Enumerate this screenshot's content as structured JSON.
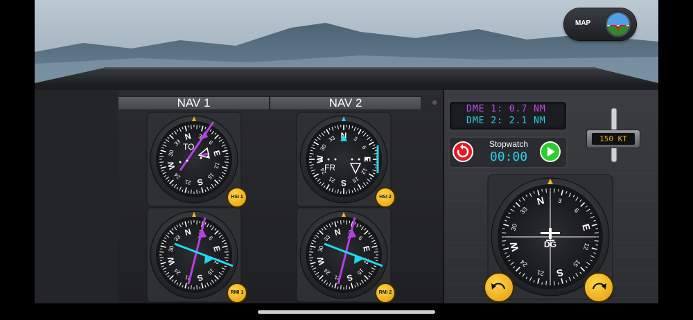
{
  "map_button": {
    "label": "MAP"
  },
  "nav_headers": {
    "nav1": "NAV 1",
    "nav2": "NAV 2"
  },
  "instruments": {
    "hsi1": {
      "label": "HSI 1",
      "flag": "TO"
    },
    "hsi2": {
      "label": "HSI 2",
      "flag": "FR"
    },
    "rmi1": {
      "label": "RMI 1"
    },
    "rmi2": {
      "label": "RMI 2"
    },
    "dg": {
      "label": "DG"
    }
  },
  "compass_labels": [
    "N",
    "3",
    "6",
    "E",
    "12",
    "15",
    "S",
    "21",
    "24",
    "W",
    "30",
    "33"
  ],
  "dme": {
    "line1": "DME 1: 0.7 NM",
    "line2": "DME 2: 2.1 NM"
  },
  "stopwatch": {
    "title": "Stopwatch",
    "time": "00:00"
  },
  "speed": {
    "value": "150 KT"
  },
  "colors": {
    "purple": "#b73fe6",
    "cyan": "#23d6f0",
    "gold": "#f0b81e",
    "green": "#2ccd2e",
    "red": "#e11b22"
  }
}
